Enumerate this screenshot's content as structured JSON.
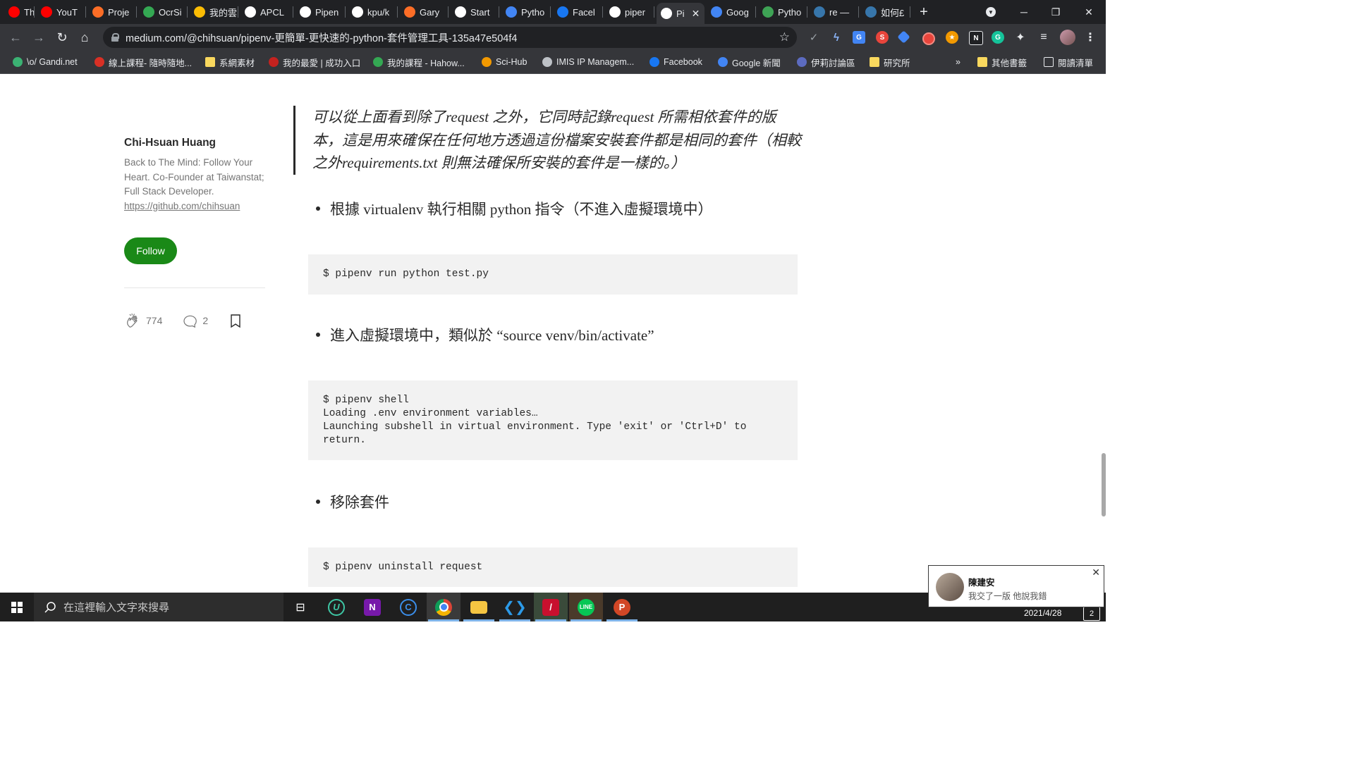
{
  "browser": {
    "tabs": [
      {
        "title": "Th",
        "icon": "youtube-icon",
        "color": "#ff0000"
      },
      {
        "title": "YouT",
        "icon": "youtube-icon",
        "color": "#ff0000"
      },
      {
        "title": "Proje",
        "icon": "gitlab-icon",
        "color": "#fc6d26"
      },
      {
        "title": "OcrSi",
        "icon": "ocr-icon",
        "color": "#34a853"
      },
      {
        "title": "我的雲",
        "icon": "google-drive-icon",
        "color": "#fbbc04"
      },
      {
        "title": "APCL",
        "icon": "github-icon",
        "color": "#ffffff"
      },
      {
        "title": "Pipen",
        "icon": "medium-icon",
        "color": "#ffffff"
      },
      {
        "title": "kpu/k",
        "icon": "github-icon",
        "color": "#ffffff"
      },
      {
        "title": "Gary",
        "icon": "gitlab-icon",
        "color": "#fc6d26"
      },
      {
        "title": "Start",
        "icon": "start-icon",
        "color": "#ffffff"
      },
      {
        "title": "Pytho",
        "icon": "python-doc-icon",
        "color": "#4285f4"
      },
      {
        "title": "Facel",
        "icon": "facebook-icon",
        "color": "#1877f2"
      },
      {
        "title": "piper",
        "icon": "google-icon",
        "color": "#ffffff"
      },
      {
        "title": "Pi",
        "icon": "medium-icon",
        "color": "#ffffff",
        "active": true
      },
      {
        "title": "Goog",
        "icon": "google-translate-icon",
        "color": "#4285f4"
      },
      {
        "title": "Pytho",
        "icon": "pypi-icon",
        "color": "#3ea355"
      },
      {
        "title": "re —",
        "icon": "python-icon",
        "color": "#3776ab"
      },
      {
        "title": "如何£",
        "icon": "python-icon",
        "color": "#3776ab"
      }
    ],
    "new_tab_label": "+",
    "url": "medium.com/@chihsuan/pipenv-更簡單-更快速的-python-套件管理工具-135a47e504f4",
    "bookmarks": [
      {
        "label": "\\o/ Gandi.net",
        "icon": "gandi-icon"
      },
      {
        "label": "線上課程- 隨時隨地...",
        "icon": "course-icon"
      },
      {
        "label": "系網素材",
        "icon": "folder-icon"
      },
      {
        "label": "我的最愛 | 成功入口",
        "icon": "ncku-icon"
      },
      {
        "label": "我的課程 - Hahow...",
        "icon": "hahow-icon"
      },
      {
        "label": "Sci-Hub",
        "icon": "scihub-icon"
      },
      {
        "label": "IMIS IP Managem...",
        "icon": "globe-icon"
      },
      {
        "label": "Facebook",
        "icon": "facebook-icon"
      },
      {
        "label": "Google 新聞",
        "icon": "google-news-icon"
      },
      {
        "label": "伊莉討論區",
        "icon": "eyny-icon"
      },
      {
        "label": "研究所",
        "icon": "folder-icon"
      }
    ],
    "bookmarks_more": "»",
    "other_bookmarks": "其他書籤",
    "reading_list": "閱讀清單"
  },
  "author": {
    "name": "Chi-Hsuan Huang",
    "bio": "Back to The Mind: Follow Your Heart. Co-Founder at Taiwanstat; Full Stack Developer.",
    "link": "https://github.com/chihsuan",
    "follow_label": "Follow",
    "claps": "774",
    "responses": "2"
  },
  "article": {
    "quote": "可以從上面看到除了request 之外，它同時記錄request 所需相依套件的版本，這是用來確保在任何地方透過這份檔案安裝套件都是相同的套件（相較之外requirements.txt 則無法確保所安裝的套件是一樣的。）",
    "bullet1": "根據 virtualenv 執行相關 python 指令（不進入虛擬環境中）",
    "code1": "$ pipenv run python test.py",
    "bullet2": "進入虛擬環境中，類似於 “source venv/bin/activate”",
    "code2": "$ pipenv shell\nLoading .env environment variables…\nLaunching subshell in virtual environment. Type 'exit' or 'Ctrl+D' to\nreturn.",
    "bullet3": "移除套件",
    "code3": "$ pipenv uninstall request"
  },
  "notification": {
    "sender": "陳建安",
    "message": "我交了一版 他說我錯"
  },
  "taskbar": {
    "search_placeholder": "在這裡輸入文字來搜尋",
    "date": "2021/4/28",
    "badge": "2"
  }
}
